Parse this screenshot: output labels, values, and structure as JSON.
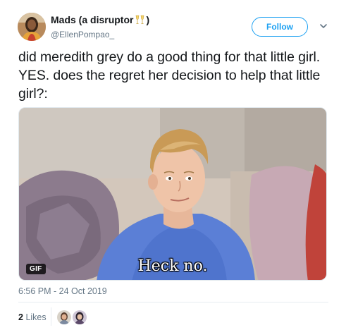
{
  "user": {
    "display_name": "Mads (a disruptor",
    "display_name_suffix": ")",
    "emoji": "champagne-glasses-emoji",
    "username": "@EllenPompao_"
  },
  "follow_label": "Follow",
  "tweet": {
    "text": "did meredith grey do a good thing for that little girl. YES. does the regret her decision to help that little girl?:"
  },
  "media": {
    "badge": "GIF",
    "caption": "Heck no."
  },
  "timestamp": "6:56 PM - 24 Oct 2019",
  "likes": {
    "count": "2",
    "label": "Likes"
  },
  "colors": {
    "accent": "#1da1f2",
    "secondary_text": "#657786",
    "primary_text": "#14171a"
  }
}
